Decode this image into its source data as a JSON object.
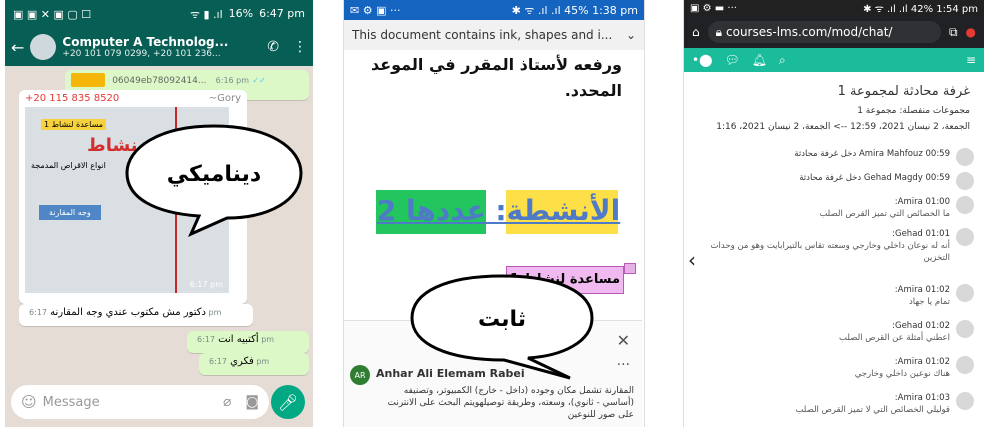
{
  "phone1": {
    "status": {
      "time": "6:47 pm",
      "battery": "16%"
    },
    "chat": {
      "title": "Computer A Technolog...",
      "subtitle": "+20 101 079 0299, +20 101 236..."
    },
    "messages": {
      "file_name": "06049eb78092414...",
      "file_time": "6:16 pm",
      "sender_number": "+20 115 835 8520",
      "sender_name": "~Gory",
      "image_badge": "مساعدة لنشاط 1",
      "image_title": "نشاط",
      "image_line": "انواع الاقراص المدمجة",
      "image_button": "وجه المقارنة",
      "image_time": "6:17 pm",
      "msg1": "دكتور مش مكتوب عندي وجه المقارنه",
      "msg1_time": "6:17 pm",
      "msg2": "أكتبيه انت",
      "msg2_time": "6:17 pm",
      "msg3": "فكري",
      "msg3_time": "6:17 pm"
    },
    "input_placeholder": "Message",
    "bubble_text": "ديناميكي"
  },
  "phone2": {
    "status": {
      "time": "1:38 pm",
      "battery": "45%"
    },
    "banner": "This document contains ink, shapes and i...",
    "doc_text": "ورفعه لأستاذ المقرر في الموعد المحدد.",
    "heading": "الأنشطة: عددها 2",
    "assist": "مساعدة لنشاط 1",
    "comment": {
      "initials": "AR",
      "author": "Anhar Ali Elemam Rabei",
      "body": "المقارنة تشمل مكان وجوده (داخل - خارج) الكمبيوتر، وتصنيفه (أساسي - ثانوي)، وسعته، وطريقة توصيلهويتم البحث على الانترنت على صور للنوعين"
    },
    "bubble_text": "ثابت"
  },
  "phone3": {
    "status": {
      "time": "1:54 pm",
      "battery": "42%"
    },
    "url": "courses-lms.com/mod/chat/",
    "page_title": "غرفة محادثة لمجموعة 1",
    "groups": "مجموعات منفصلة: مجموعة 1",
    "date_range": "الجمعة، 2 نيسان 2021، 12:59 --> الجمعة، 2 نيسان 2021، 1:16",
    "chat": [
      {
        "text": "00:59 Amira Mahfouz دخل غرفة محادثة",
        "sub": ""
      },
      {
        "text": "00:59 Gehad Magdy دخل غرفة محادثة",
        "sub": ""
      },
      {
        "text": "Amira 01:00:",
        "sub": "ما الخصائص التي تميز القرص الصلب"
      },
      {
        "text": "Gehad 01:01:",
        "sub": "أنه له نوعان داخلي وخارجي وسعته تقاس بالتيرابايت وهو من وحدات التخزين"
      },
      {
        "text": "Amira 01:02:",
        "sub": "تمام يا جهاد"
      },
      {
        "text": "Gehad 01:02:",
        "sub": "اعطني أمثلة عن القرص الصلب"
      },
      {
        "text": "Amira 01:02:",
        "sub": "هناك نوعين داخلي وخارجي"
      },
      {
        "text": "Amira 01:03:",
        "sub": "قوليلي الخصائص التي لا تميز القرص الصلب"
      }
    ]
  }
}
